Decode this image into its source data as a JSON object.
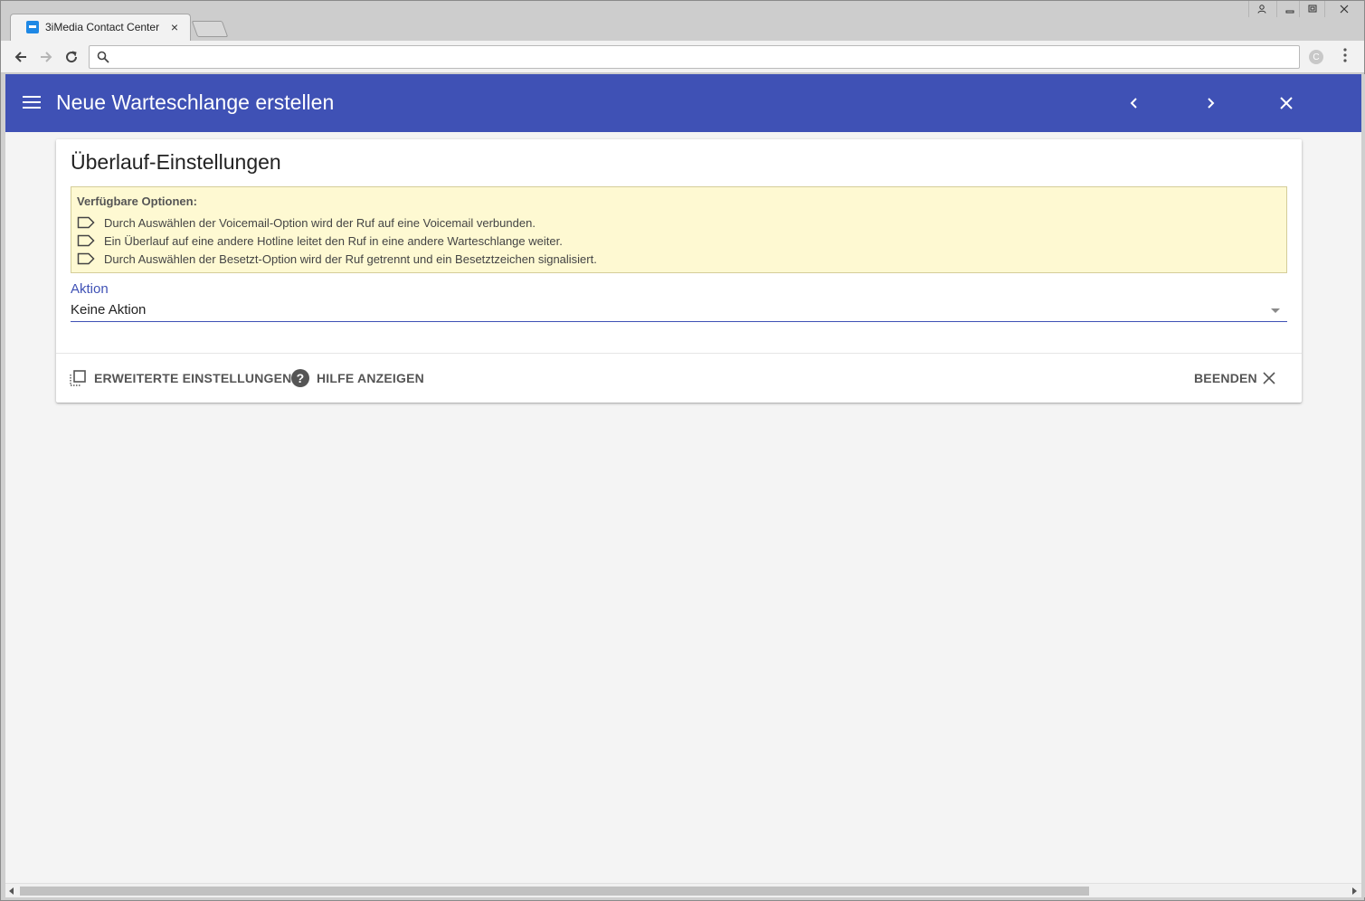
{
  "browser": {
    "tab_title": "3iMedia Contact Center",
    "tab_close": "×",
    "address_value": "",
    "ext_icon_letter": "C"
  },
  "appbar": {
    "title": "Neue Warteschlange erstellen",
    "color": "#3f51b5"
  },
  "card": {
    "title": "Überlauf-Einstellungen",
    "info": {
      "heading": "Verfügbare Optionen:",
      "lines": [
        "Durch Auswählen der Voicemail-Option wird der Ruf auf eine Voicemail verbunden.",
        "Ein Überlauf auf eine andere Hotline leitet den Ruf in eine andere Warteschlange weiter.",
        "Durch Auswählen der Besetzt-Option wird der Ruf getrennt und ein Besetztzeichen signalisiert."
      ],
      "background": "#fef9d2"
    },
    "field": {
      "label": "Aktion",
      "value": "Keine Aktion"
    },
    "actions": {
      "advanced": "ERWEITERTE EINSTELLUNGEN",
      "help": "HILFE ANZEIGEN",
      "finish": "BEENDEN"
    }
  }
}
